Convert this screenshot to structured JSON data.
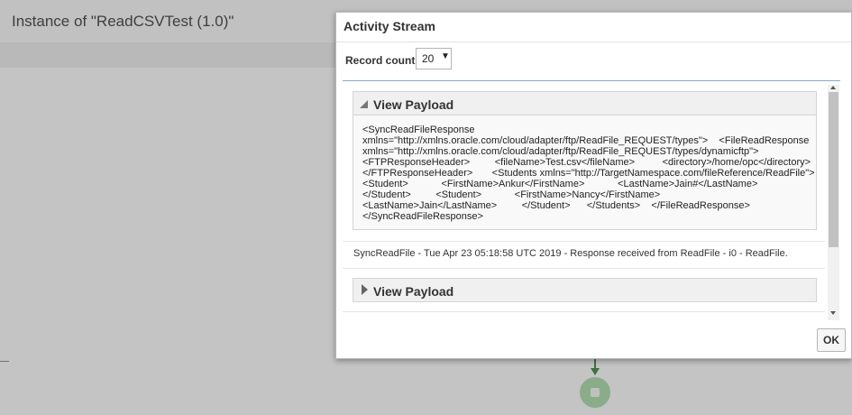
{
  "background": {
    "title": "Instance of \"ReadCSVTest (1.0)\""
  },
  "dialog": {
    "title": "Activity Stream",
    "record_count": {
      "label": "Record count",
      "value": "20"
    },
    "stream": [
      {
        "label": "View Payload",
        "expanded": true,
        "lines": [
          "<SyncReadFileResponse",
          "xmlns=\"http://xmlns.oracle.com/cloud/adapter/ftp/ReadFile_REQUEST/types\">    <FileReadResponse",
          "xmlns=\"http://xmlns.oracle.com/cloud/adapter/ftp/ReadFile_REQUEST/types/dynamicftp\">",
          "<FTPResponseHeader>         <fileName>Test.csv</fileName>          <directory>/home/opc</directory>",
          "</FTPResponseHeader>       <Students xmlns=\"http://TargetNamespace.com/fileReference/ReadFile\">",
          "<Student>            <FirstName>Ankur</FirstName>            <LastName>Jain#</LastName>",
          "</Student>         <Student>            <FirstName>Nancy</FirstName>",
          "<LastName>Jain</LastName>         </Student>      </Students>    </FileReadResponse>",
          "</SyncReadFileResponse>"
        ]
      },
      {
        "event": "SyncReadFile - Tue Apr 23 05:18:58 UTC 2019 - Response received from ReadFile - i0 - ReadFile."
      },
      {
        "label": "View Payload",
        "expanded": false
      }
    ],
    "ok_label": "OK"
  }
}
